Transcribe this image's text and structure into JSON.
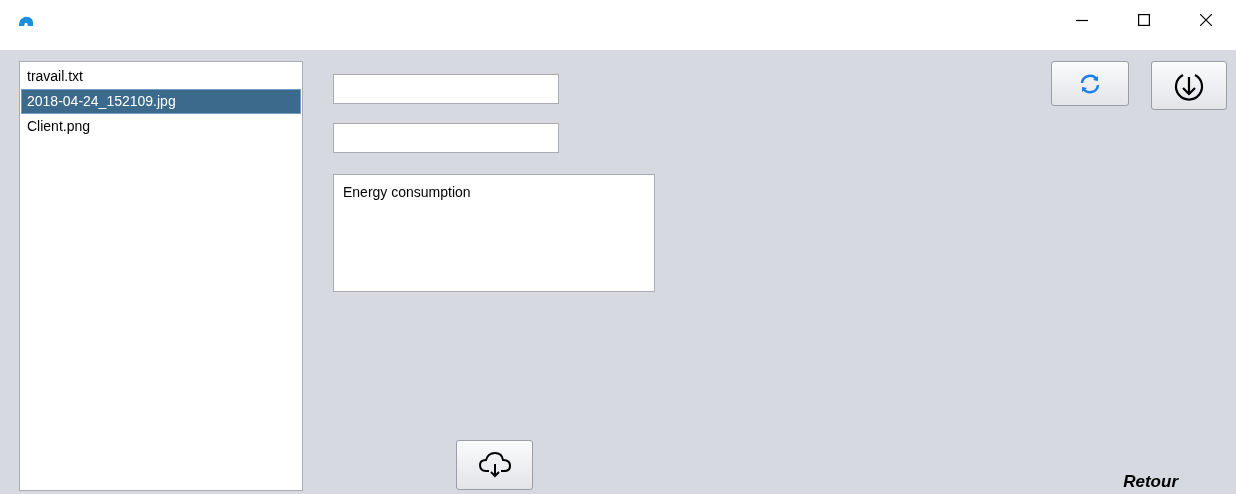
{
  "files": [
    {
      "name": "travail.txt",
      "selected": false
    },
    {
      "name": "2018-04-24_152109.jpg",
      "selected": true
    },
    {
      "name": "Client.png",
      "selected": false
    }
  ],
  "fields": [
    {
      "kind": "text"
    },
    {
      "kind": "text"
    }
  ],
  "description": {
    "value": "Energy consumption"
  },
  "back_link": "Retour"
}
